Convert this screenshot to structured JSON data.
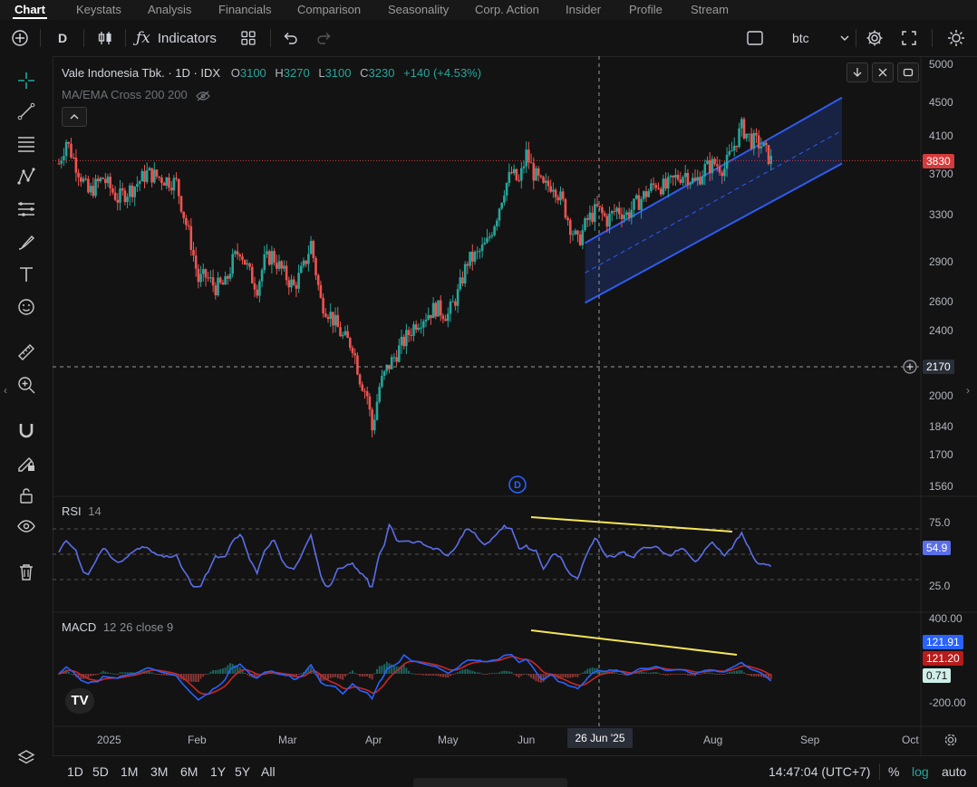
{
  "nav": {
    "tabs": [
      "Chart",
      "Keystats",
      "Analysis",
      "Financials",
      "Comparison",
      "Seasonality",
      "Corp. Action",
      "Insider",
      "Profile",
      "Stream"
    ]
  },
  "toolbar": {
    "interval": "D",
    "indicators_label": "Indicators",
    "compare_value": "btc"
  },
  "legend": {
    "symbol": "Vale Indonesia Tbk. · 1D · IDX",
    "o_label": "O",
    "o": "3100",
    "h_label": "H",
    "h": "3270",
    "l_label": "L",
    "l": "3100",
    "c_label": "C",
    "c": "3230",
    "change": "+140 (+4.53%)",
    "indicator": "MA/EMA Cross 200 200"
  },
  "price_axis": [
    "5000",
    "4500",
    "4100",
    "3700",
    "3300",
    "2900",
    "2600",
    "2400",
    "2000",
    "1840",
    "1700",
    "1560"
  ],
  "price_labels": {
    "last": "3830",
    "crosshair": "2170"
  },
  "rsi": {
    "title": "RSI",
    "param": "14",
    "levels": [
      "75.0",
      "25.0"
    ],
    "value": "54.9"
  },
  "macd": {
    "title": "MACD",
    "params": "12 26 close 9",
    "levels": [
      "400.00",
      "-200.00"
    ],
    "macd_value": "121.91",
    "signal_value": "121.20",
    "hist_value": "0.71"
  },
  "time_axis": [
    "2025",
    "Feb",
    "Mar",
    "Apr",
    "May",
    "Jun",
    "Aug",
    "Sep",
    "Oct"
  ],
  "crosshair_date": "26 Jun '25",
  "ranges": [
    "1D",
    "5D",
    "1M",
    "3M",
    "6M",
    "1Y",
    "5Y",
    "All"
  ],
  "clock": "14:47:04 (UTC+7)",
  "scale_opts": {
    "pct": "%",
    "log": "log",
    "auto": "auto"
  },
  "colors": {
    "up": "#26a69a",
    "down": "#ef5350",
    "channel": "#2f5cf0",
    "rsi": "#5b6ee8",
    "macd": "#2962ff",
    "signal": "#c62828",
    "divergence": "#f5e55b"
  },
  "chart_data": {
    "type": "candlestick",
    "symbol": "Vale Indonesia Tbk. · 1D · IDX",
    "y_scale": "log",
    "ylim": [
      1560,
      5000
    ],
    "close_path": [
      [
        0,
        3800
      ],
      [
        6,
        4050
      ],
      [
        12,
        3850
      ],
      [
        24,
        3500
      ],
      [
        36,
        3650
      ],
      [
        48,
        3450
      ],
      [
        60,
        3550
      ],
      [
        72,
        3700
      ],
      [
        84,
        3650
      ],
      [
        96,
        3600
      ],
      [
        102,
        3300
      ],
      [
        108,
        3050
      ],
      [
        114,
        2750
      ],
      [
        120,
        2780
      ],
      [
        128,
        2700
      ],
      [
        136,
        2720
      ],
      [
        142,
        2900
      ],
      [
        148,
        3000
      ],
      [
        156,
        2800
      ],
      [
        162,
        2700
      ],
      [
        168,
        2900
      ],
      [
        174,
        2950
      ],
      [
        184,
        2800
      ],
      [
        192,
        2700
      ],
      [
        200,
        2850
      ],
      [
        206,
        3050
      ],
      [
        214,
        2600
      ],
      [
        222,
        2500
      ],
      [
        232,
        2350
      ],
      [
        240,
        2300
      ],
      [
        246,
        2100
      ],
      [
        252,
        2000
      ],
      [
        256,
        1820
      ],
      [
        262,
        2050
      ],
      [
        268,
        2150
      ],
      [
        276,
        2250
      ],
      [
        284,
        2350
      ],
      [
        292,
        2450
      ],
      [
        300,
        2500
      ],
      [
        308,
        2550
      ],
      [
        318,
        2500
      ],
      [
        326,
        2650
      ],
      [
        334,
        2900
      ],
      [
        342,
        2950
      ],
      [
        350,
        3050
      ],
      [
        358,
        3300
      ],
      [
        364,
        3550
      ],
      [
        370,
        3700
      ],
      [
        376,
        3600
      ],
      [
        382,
        3900
      ],
      [
        388,
        3700
      ],
      [
        396,
        3550
      ],
      [
        404,
        3600
      ],
      [
        412,
        3400
      ],
      [
        418,
        3200
      ],
      [
        424,
        3050
      ],
      [
        432,
        3250
      ],
      [
        440,
        3350
      ],
      [
        448,
        3250
      ],
      [
        456,
        3350
      ],
      [
        464,
        3300
      ],
      [
        472,
        3400
      ],
      [
        480,
        3500
      ],
      [
        488,
        3600
      ],
      [
        496,
        3550
      ],
      [
        504,
        3650
      ],
      [
        512,
        3700
      ],
      [
        520,
        3600
      ],
      [
        528,
        3750
      ],
      [
        536,
        3800
      ],
      [
        544,
        3750
      ],
      [
        552,
        4000
      ],
      [
        558,
        4200
      ],
      [
        566,
        4050
      ],
      [
        574,
        4000
      ],
      [
        582,
        3830
      ]
    ],
    "channel_upper": [
      [
        3050,
        0
      ],
      [
        3650,
        282
      ]
    ],
    "channel_lower": [
      [
        3080,
        0
      ],
      [
        3800,
        282
      ]
    ],
    "rsi_14": {
      "last": 54.9,
      "levels": [
        75,
        50,
        25
      ]
    },
    "macd": {
      "macd": 121.91,
      "signal": 121.2,
      "histogram": 0.71
    }
  }
}
